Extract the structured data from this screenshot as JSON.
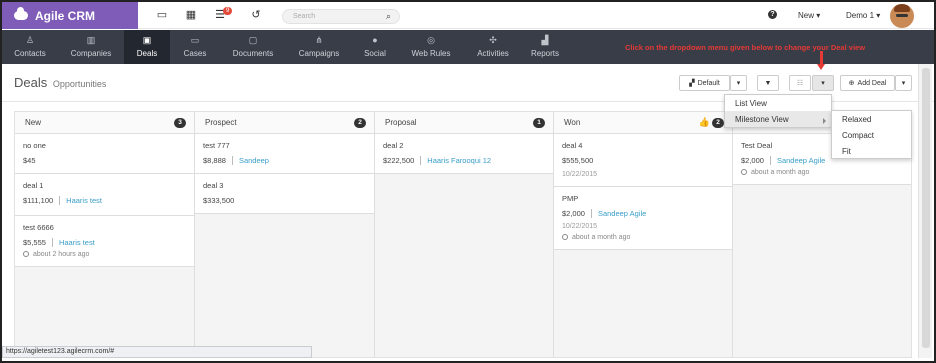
{
  "brand": {
    "name": "Agile CRM"
  },
  "topbar": {
    "notification_count": "9",
    "search_placeholder": "Search",
    "new_label": "New",
    "user_label": "Demo 1"
  },
  "nav": [
    {
      "label": "Contacts",
      "icon": "contacts-icon"
    },
    {
      "label": "Companies",
      "icon": "companies-icon"
    },
    {
      "label": "Deals",
      "icon": "deals-icon",
      "active": true
    },
    {
      "label": "Cases",
      "icon": "cases-icon"
    },
    {
      "label": "Documents",
      "icon": "documents-icon"
    },
    {
      "label": "Campaigns",
      "icon": "campaigns-icon"
    },
    {
      "label": "Social",
      "icon": "social-icon"
    },
    {
      "label": "Web Rules",
      "icon": "web-rules-icon"
    },
    {
      "label": "Activities",
      "icon": "activities-icon"
    },
    {
      "label": "Reports",
      "icon": "reports-icon"
    }
  ],
  "annotation": "Click on the dropdown menu given below to change your Deal view",
  "page": {
    "title": "Deals",
    "subtitle": "Opportunities"
  },
  "toolbar": {
    "default_label": "Default",
    "add_deal_label": "Add Deal"
  },
  "view_menu": {
    "items": [
      "List View",
      "Milestone View"
    ],
    "submenu": [
      "Relaxed",
      "Compact",
      "Fit"
    ]
  },
  "columns": [
    {
      "title": "New",
      "count": "3",
      "cards": [
        {
          "name": "no one",
          "value": "$45"
        },
        {
          "name": "deal 1",
          "value": "$111,100",
          "contact": "Haaris test"
        },
        {
          "name": "test 6666",
          "value": "$5,555",
          "contact": "Haaris test",
          "ago": "about 2 hours ago"
        }
      ]
    },
    {
      "title": "Prospect",
      "count": "2",
      "cards": [
        {
          "name": "test 777",
          "value": "$8,888",
          "contact": "Sandeep"
        },
        {
          "name": "deal 3",
          "value": "$333,500"
        }
      ]
    },
    {
      "title": "Proposal",
      "count": "1",
      "cards": [
        {
          "name": "deal 2",
          "value": "$222,500",
          "contact": "Haaris Farooqui 12"
        }
      ]
    },
    {
      "title": "Won",
      "count": "2",
      "cards": [
        {
          "name": "deal 4",
          "value": "$555,500",
          "date": "10/22/2015"
        },
        {
          "name": "PMP",
          "value": "$2,000",
          "contact": "Sandeep Agile",
          "date": "10/22/2015",
          "ago": "about a month ago"
        }
      ]
    },
    {
      "title": "",
      "count": "",
      "cards": [
        {
          "name": "Test Deal",
          "value": "$2,000",
          "contact": "Sandeep Agile",
          "ago": "about a month ago"
        }
      ]
    }
  ],
  "status_url": "https://agiletest123.agilecrm.com/#",
  "colors": {
    "brand": "#7e5cb8",
    "nav_bg": "#383d48",
    "link": "#3a9ec9",
    "annotation": "#e53935"
  }
}
